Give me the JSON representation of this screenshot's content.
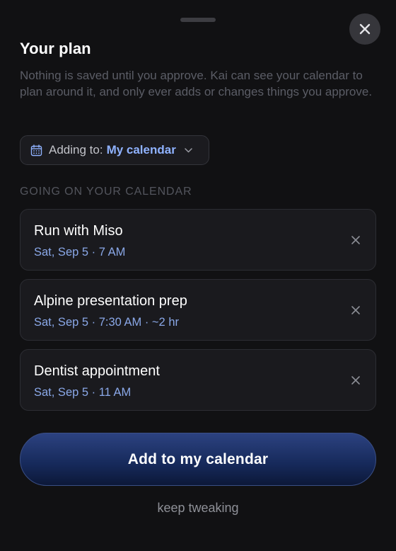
{
  "sheet": {
    "title": "Your plan",
    "description": "Nothing is saved until you approve. Kai can see your calendar to plan around it, and only ever adds or changes things you approve.",
    "close_icon": "close-icon"
  },
  "target": {
    "prefix": "Adding to:",
    "value": "My calendar",
    "icon": "calendar-icon"
  },
  "section_label": "GOING ON YOUR CALENDAR",
  "events": [
    {
      "title": "Run with Miso",
      "meta": "Sat, Sep 5 · 7 AM"
    },
    {
      "title": "Alpine presentation prep",
      "meta": "Sat, Sep 5 · 7:30 AM · ~2 hr"
    },
    {
      "title": "Dentist appointment",
      "meta": "Sat, Sep 5 · 11 AM"
    }
  ],
  "actions": {
    "primary_label": "Add to my calendar",
    "secondary_label": "keep tweaking"
  },
  "colors": {
    "background": "#111113",
    "accent": "#8fb2ff",
    "button_gradient_top": "#2c4280",
    "button_gradient_bottom": "#0c1838"
  }
}
